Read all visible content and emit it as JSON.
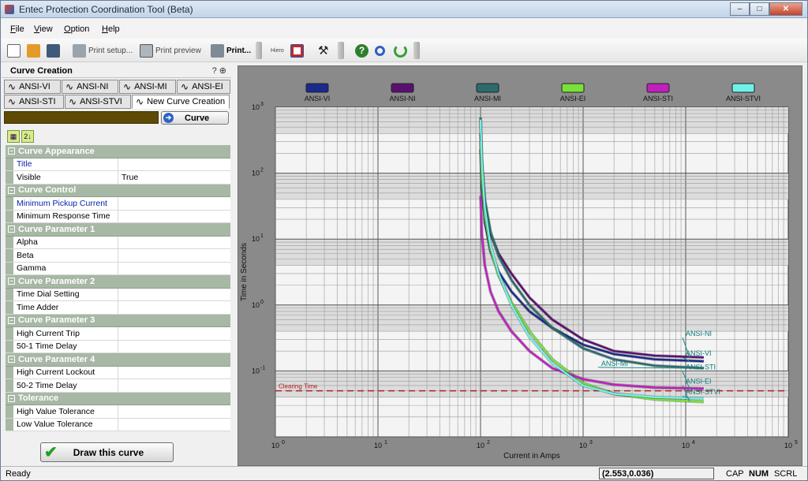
{
  "window": {
    "title": "Entec Protection Coordination Tool (Beta)",
    "controls": [
      "–",
      "□",
      "✕"
    ]
  },
  "menu": [
    {
      "u": "F",
      "rest": "ile"
    },
    {
      "u": "V",
      "rest": "iew"
    },
    {
      "u": "O",
      "rest": "ption"
    },
    {
      "u": "H",
      "rest": "elp"
    }
  ],
  "toolbar": {
    "print_setup": "Print setup...",
    "print_preview": "Print preview",
    "print": "Print...",
    "small_label": "Hiero",
    "colors": {
      "new": "#ffffff",
      "open": "#e39a2b",
      "save": "#3f5a7a",
      "help": "#2f7d2f",
      "find": "#3060c0",
      "refresh": "#36a035"
    }
  },
  "panel": {
    "title": "Curve Creation",
    "pin": "? ⊕",
    "tabs_row1": [
      "ANSI-VI",
      "ANSI-NI",
      "ANSI-MI",
      "ANSI-EI"
    ],
    "tabs_row2": [
      "ANSI-STI",
      "ANSI-STVI",
      "New Curve Creation"
    ],
    "curve_button": "Curve",
    "sort_icons": [
      "▦",
      "2↓"
    ]
  },
  "properties": [
    {
      "category": "Curve Appearance",
      "rows": [
        {
          "label": "Title",
          "value": "",
          "blue": true
        },
        {
          "label": "Visible",
          "value": "True",
          "blue": false
        }
      ]
    },
    {
      "category": "Curve Control",
      "rows": [
        {
          "label": "Minimum Pickup Current",
          "value": "",
          "blue": true
        },
        {
          "label": "Minimum Response Time",
          "value": "",
          "blue": false
        }
      ]
    },
    {
      "category": "Curve Parameter 1",
      "rows": [
        {
          "label": "Alpha",
          "value": "",
          "blue": false
        },
        {
          "label": "Beta",
          "value": "",
          "blue": false
        },
        {
          "label": "Gamma",
          "value": "",
          "blue": false
        }
      ]
    },
    {
      "category": "Curve Parameter 2",
      "rows": [
        {
          "label": "Time Dial Setting",
          "value": "",
          "blue": false
        },
        {
          "label": "Time Adder",
          "value": "",
          "blue": false
        }
      ]
    },
    {
      "category": "Curve Parameter 3",
      "rows": [
        {
          "label": "High Current Trip",
          "value": "",
          "blue": false
        },
        {
          "label": "50-1 Time Delay",
          "value": "",
          "blue": false
        }
      ]
    },
    {
      "category": "Curve Parameter 4",
      "rows": [
        {
          "label": "High Current Lockout",
          "value": "",
          "blue": false
        },
        {
          "label": "50-2 Time Delay",
          "value": "",
          "blue": false
        }
      ]
    },
    {
      "category": "Tolerance",
      "rows": [
        {
          "label": "High Value Tolerance",
          "value": "",
          "blue": false
        },
        {
          "label": "Low Value Tolerance",
          "value": "",
          "blue": false
        }
      ]
    }
  ],
  "draw_button": "Draw this curve",
  "status": {
    "ready": "Ready",
    "coord": "(2.553,0.036)",
    "cap": "CAP",
    "num": "NUM",
    "scrl": "SCRL"
  },
  "chart_data": {
    "type": "line",
    "xscale": "log",
    "yscale": "log",
    "xlabel": "Current in Amps",
    "ylabel": "Time in Seconds",
    "xlim": [
      1,
      100000
    ],
    "ylim": [
      0.01,
      1000
    ],
    "xticks": [
      {
        "v": 1,
        "b": "10",
        "e": "0"
      },
      {
        "v": 10,
        "b": "10",
        "e": "1"
      },
      {
        "v": 100,
        "b": "10",
        "e": "2"
      },
      {
        "v": 1000,
        "b": "10",
        "e": "3"
      },
      {
        "v": 10000,
        "b": "10",
        "e": "4"
      },
      {
        "v": 100000,
        "b": "10",
        "e": "5"
      }
    ],
    "yticks": [
      {
        "v": 1000,
        "b": "10",
        "e": "3"
      },
      {
        "v": 100,
        "b": "10",
        "e": "2"
      },
      {
        "v": 10,
        "b": "10",
        "e": "1"
      },
      {
        "v": 1,
        "b": "10",
        "e": "0"
      },
      {
        "v": 0.1,
        "b": "10",
        "e": "-1"
      }
    ],
    "grid": true,
    "legend_position": "top",
    "clearing_time": {
      "label": "Clearing Time",
      "value": 0.05,
      "color": "#b02020"
    },
    "series": [
      {
        "name": "ANSI-VI",
        "color": "#1a2a8c",
        "label": "ANSI-VI",
        "label_at": [
          10000,
          0.17
        ],
        "x": [
          100,
          103,
          110,
          125,
          150,
          200,
          300,
          500,
          1000,
          2000,
          5000,
          15000
        ],
        "y": [
          230,
          60,
          18,
          6.5,
          3.2,
          1.6,
          0.8,
          0.45,
          0.25,
          0.18,
          0.15,
          0.14
        ]
      },
      {
        "name": "ANSI-NI",
        "color": "#5a1070",
        "label": "ANSI-NI",
        "label_at": [
          10000,
          0.34
        ],
        "x": [
          100,
          103,
          110,
          125,
          150,
          200,
          300,
          500,
          1000,
          2000,
          5000,
          15000
        ],
        "y": [
          400,
          110,
          35,
          12,
          6,
          3,
          1.3,
          0.6,
          0.3,
          0.2,
          0.17,
          0.16
        ]
      },
      {
        "name": "ANSI-MI",
        "color": "#2d6b6b",
        "label": "ANSI-MI",
        "label_at": [
          1500,
          0.12
        ],
        "x": [
          100,
          103,
          110,
          125,
          150,
          200,
          300,
          500,
          1000,
          2000,
          5000,
          15000
        ],
        "y": [
          700,
          150,
          40,
          13,
          5.5,
          2.4,
          1,
          0.45,
          0.22,
          0.15,
          0.12,
          0.11
        ]
      },
      {
        "name": "ANSI-EI",
        "color": "#7ae03a",
        "label": "ANSI-EI",
        "label_at": [
          10000,
          0.064
        ],
        "x": [
          100,
          103,
          110,
          125,
          150,
          200,
          300,
          500,
          1000,
          2000,
          5000,
          15000
        ],
        "y": [
          300,
          80,
          22,
          7,
          2.8,
          1.1,
          0.4,
          0.15,
          0.065,
          0.045,
          0.037,
          0.034
        ]
      },
      {
        "name": "ANSI-STI",
        "color": "#c020c0",
        "label": "ANSI-STI",
        "label_at": [
          10000,
          0.105
        ],
        "x": [
          100,
          103,
          110,
          125,
          150,
          200,
          300,
          500,
          1000,
          2000,
          5000,
          15000
        ],
        "y": [
          45,
          12,
          4,
          1.6,
          0.8,
          0.4,
          0.2,
          0.11,
          0.075,
          0.062,
          0.056,
          0.054
        ]
      },
      {
        "name": "ANSI-STVI",
        "color": "#70f0e8",
        "label": "ANSI-STVI",
        "label_at": [
          10000,
          0.044
        ],
        "x": [
          100,
          103,
          110,
          125,
          150,
          200,
          300,
          500,
          1000,
          2000,
          5000,
          15000
        ],
        "y": [
          650,
          140,
          30,
          8,
          3,
          1,
          0.33,
          0.13,
          0.06,
          0.045,
          0.04,
          0.038
        ]
      }
    ]
  }
}
